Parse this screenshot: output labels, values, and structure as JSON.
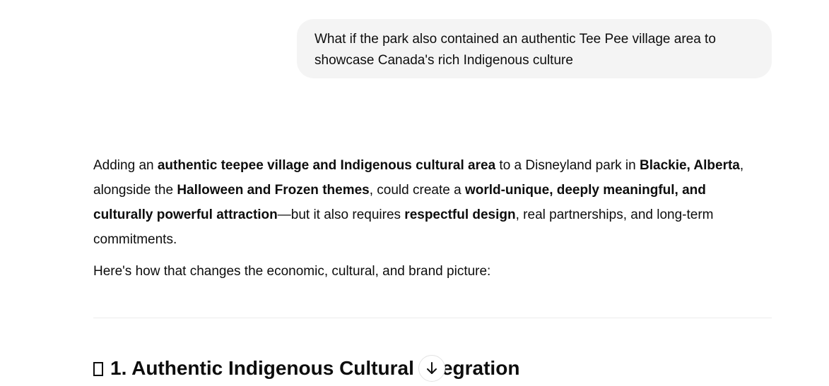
{
  "user_message": {
    "line1": "What if the park also contained an authentic Tee Pee village area to",
    "line2": "showcase Canada's rich Indigenous culture"
  },
  "response": {
    "p1": {
      "s1": "Adding an ",
      "b1": "authentic teepee village and Indigenous cultural area",
      "s2": " to a Disneyland park in ",
      "b2": "Blackie, Alberta",
      "s3": ",",
      "s4": "alongside the ",
      "b3": "Halloween and Frozen themes",
      "s5": ", could create a ",
      "b4": "world-unique, deeply meaningful, and",
      "b5": "culturally powerful attraction",
      "s6": "—but it also requires ",
      "b6": "respectful design",
      "s7": ", real partnerships, and long-term",
      "s8": "commitments."
    },
    "p2": "Here's how that changes the economic, cultural, and brand picture:"
  },
  "section_heading": {
    "text_before": "1. Authentic Indigenous Cultural ",
    "text_after": "tegration",
    "icon": "missing-glyph-emoji"
  },
  "scroll_button": {
    "icon": "arrow-down-icon"
  }
}
